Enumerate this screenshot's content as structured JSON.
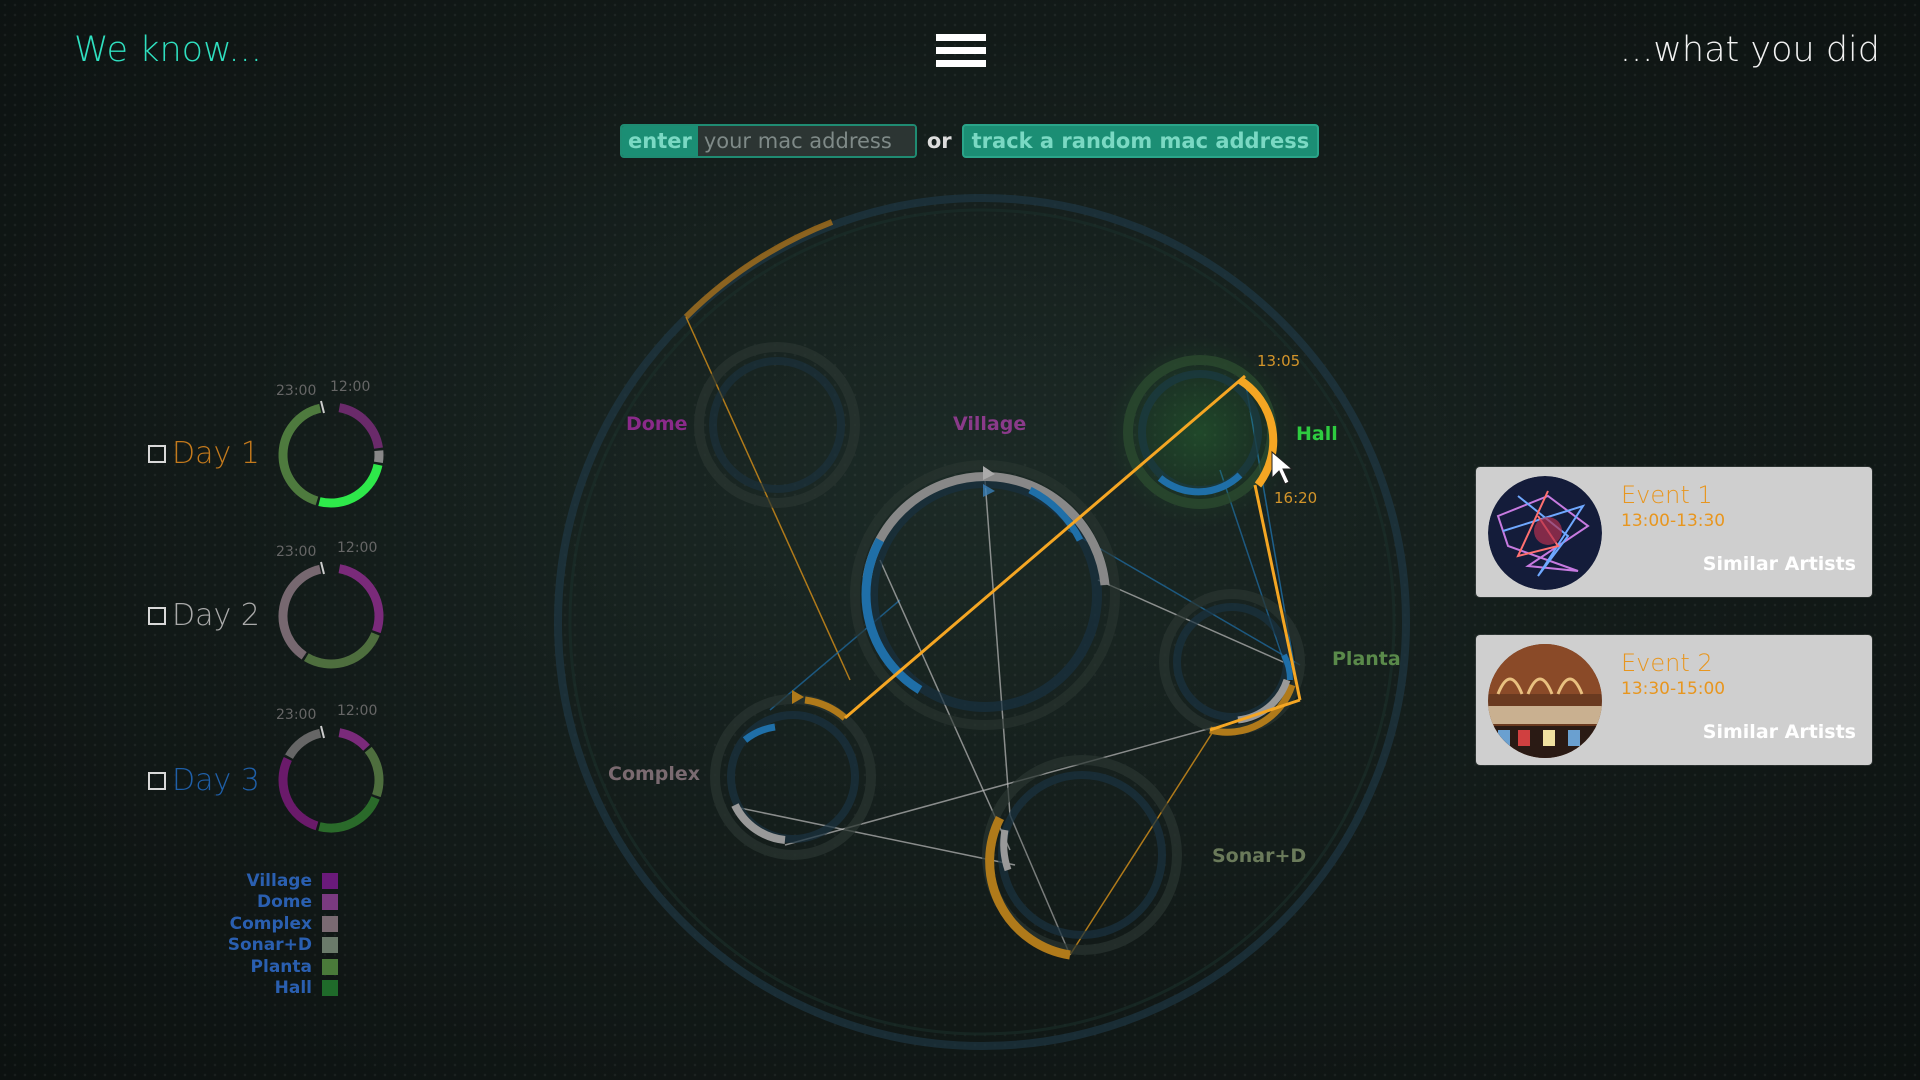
{
  "header": {
    "left_text": "We know...",
    "right_text": "...what you did",
    "menu_icon": "hamburger-icon"
  },
  "search": {
    "enter_label": "enter",
    "input_placeholder": "your mac address",
    "or_label": "or",
    "track_button": "track a random mac address"
  },
  "days": [
    {
      "label": "Day 1",
      "color": "#c47a1c",
      "time_start": "23:00",
      "time_end": "12:00",
      "segments": [
        {
          "venue": "Village",
          "color": "#6a2a6a",
          "fraction": 0.22
        },
        {
          "venue": "Complex",
          "color": "#888888",
          "fraction": 0.05
        },
        {
          "venue": "Hall",
          "color": "#2ee84a",
          "fraction": 0.28
        },
        {
          "venue": "Planta",
          "color": "#4e7a3e",
          "fraction": 0.45
        }
      ]
    },
    {
      "label": "Day 2",
      "color": "#aaaaaa",
      "time_start": "23:00",
      "time_end": "12:00",
      "segments": [
        {
          "venue": "Dome",
          "color": "#7a2a7a",
          "fraction": 0.3
        },
        {
          "venue": "Planta",
          "color": "#4e6e3e",
          "fraction": 0.3
        },
        {
          "venue": "Complex",
          "color": "#776870",
          "fraction": 0.4
        }
      ]
    },
    {
      "label": "Day 3",
      "color": "#1f5fa8",
      "time_start": "23:00",
      "time_end": "12:00",
      "segments": [
        {
          "venue": "Dome",
          "color": "#7a2a7a",
          "fraction": 0.12
        },
        {
          "venue": "Planta",
          "color": "#4e6e3e",
          "fraction": 0.18
        },
        {
          "venue": "Hall",
          "color": "#2a6a2a",
          "fraction": 0.25
        },
        {
          "venue": "Village",
          "color": "#6a1a6a",
          "fraction": 0.3
        },
        {
          "venue": "Complex",
          "color": "#666666",
          "fraction": 0.15
        }
      ]
    }
  ],
  "legend": [
    {
      "label": "Village",
      "color": "#6a1a7a"
    },
    {
      "label": "Dome",
      "color": "#7a3a80"
    },
    {
      "label": "Complex",
      "color": "#7a6a72"
    },
    {
      "label": "Sonar+D",
      "color": "#6a7a6a"
    },
    {
      "label": "Planta",
      "color": "#4a7a3a"
    },
    {
      "label": "Hall",
      "color": "#1f6a2a"
    }
  ],
  "venues": [
    {
      "name": "Dome",
      "color": "#8a2a8a"
    },
    {
      "name": "Village",
      "color": "#8a3a8a"
    },
    {
      "name": "Hall",
      "color": "#2ecc40"
    },
    {
      "name": "Planta",
      "color": "#5a8a4a"
    },
    {
      "name": "Complex",
      "color": "#7a6a70"
    },
    {
      "name": "Sonar+D",
      "color": "#6a7a5a"
    }
  ],
  "hall_times": {
    "start": "13:05",
    "end": "16:20"
  },
  "events": [
    {
      "title": "Event 1",
      "time": "13:00-13:30",
      "action": "Similar Artists"
    },
    {
      "title": "Event 2",
      "time": "13:30-15:00",
      "action": "Similar Artists"
    }
  ],
  "colors": {
    "accent": "#2fe0c0",
    "orange": "#f5a623",
    "teal_button": "#1b8e74",
    "blue": "#1f6fa8"
  }
}
